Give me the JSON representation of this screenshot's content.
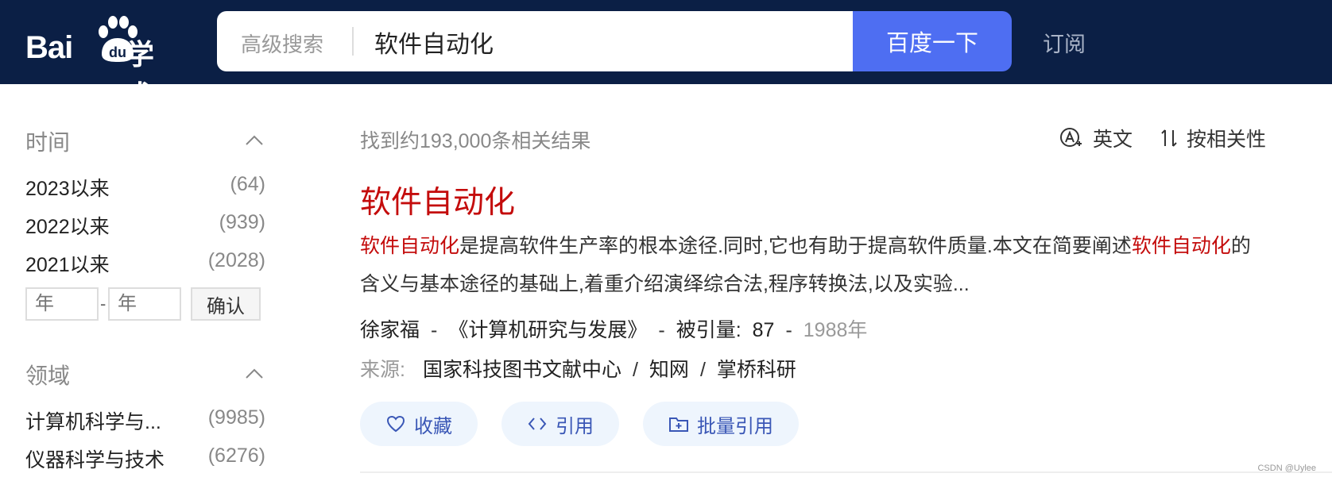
{
  "header": {
    "logo_bai": "Bai",
    "logo_du": "du",
    "logo_xueshu": "学术",
    "advanced_search": "高级搜索",
    "search_value": "软件自动化",
    "search_button": "百度一下",
    "subscribe": "订阅"
  },
  "sidebar": {
    "time": {
      "title": "时间",
      "items": [
        {
          "label": "2023以来",
          "count": "(64)"
        },
        {
          "label": "2022以来",
          "count": "(939)"
        },
        {
          "label": "2021以来",
          "count": "(2028)"
        }
      ],
      "year_placeholder_from": "年",
      "year_placeholder_to": "年",
      "dash": "-",
      "confirm": "确认"
    },
    "field": {
      "title": "领域",
      "items": [
        {
          "label": "计算机科学与...",
          "count": "(9985)"
        },
        {
          "label": "仪器科学与技术",
          "count": "(6276)"
        }
      ]
    }
  },
  "results": {
    "count_text": "找到约193,000条相关结果",
    "lang_label": "英文",
    "sort_label": "按相关性",
    "items": [
      {
        "title": "软件自动化",
        "abstract_hl1": "软件自动化",
        "abstract_part1": "是提高软件生产率的根本途径.同时,它也有助于提高软件质量.本文在简要阐述",
        "abstract_hl2": "软件自动化",
        "abstract_part2": "的含义与基本途径的基础上,着重介绍演绎综合法,程序转换法,以及实验...",
        "author": "徐家福",
        "journal": "《计算机研究与发展》",
        "cited_label": "被引量:",
        "cited_count": "87",
        "year": "1988年",
        "source_label": "来源:",
        "sources": [
          "国家科技图书文献中心",
          "知网",
          "掌桥科研"
        ],
        "actions": {
          "collect": "收藏",
          "cite": "引用",
          "batch_cite": "批量引用"
        }
      }
    ]
  },
  "watermark": "CSDN @Uylee",
  "colors": {
    "header_bg": "#0b1f45",
    "search_button": "#4e6ef2",
    "highlight": "#c40c0c",
    "action_bg": "#eef5fd",
    "action_text": "#3a57b6"
  }
}
